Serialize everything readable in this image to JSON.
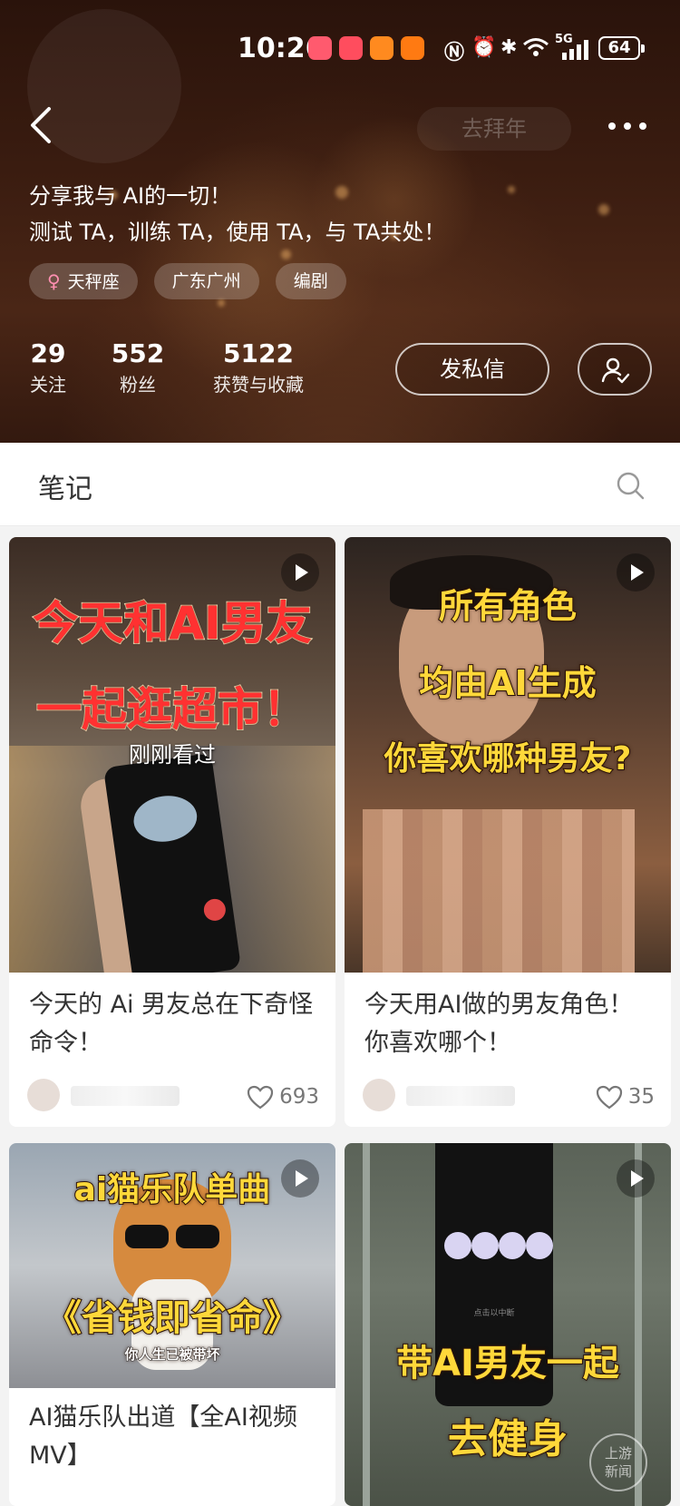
{
  "status_bar": {
    "time": "10:26",
    "battery": "64",
    "network": "5G"
  },
  "header": {
    "ghost_pill": "去拜年",
    "bio_lines": [
      "分享我与 AI的一切！",
      "测试 TA，训练 TA，使用 TA，与 TA共处！"
    ],
    "tags": [
      {
        "label": "天秤座",
        "icon": "female-icon"
      },
      {
        "label": "广东广州"
      },
      {
        "label": "编剧"
      }
    ],
    "stats": [
      {
        "value": "29",
        "label": "关注"
      },
      {
        "value": "552",
        "label": "粉丝"
      },
      {
        "value": "5122",
        "label": "获赞与收藏"
      }
    ],
    "message_button": "发私信"
  },
  "tabs": {
    "notes": "笔记"
  },
  "cards": [
    {
      "caption_lines": [
        "今天和AI男友",
        "一起逛超市！"
      ],
      "watched": "刚刚看过",
      "title": "今天的 Ai 男友总在下奇怪命令！",
      "likes": "693"
    },
    {
      "caption_lines": [
        "所有角色",
        "均由AI生成",
        "你喜欢哪种男友?"
      ],
      "title": "今天用AI做的男友角色！你喜欢哪个！",
      "likes": "35"
    },
    {
      "caption_lines": [
        "ai猫乐队单曲",
        "《省钱即省命》",
        "你人生已被带坏"
      ],
      "title": "AI猫乐队出道【全AI视频MV】"
    },
    {
      "caption_lines": [
        "带AI男友一起",
        "去健身"
      ],
      "screen_text": "点击以中断"
    }
  ],
  "watermark": [
    "上游",
    "新闻"
  ]
}
